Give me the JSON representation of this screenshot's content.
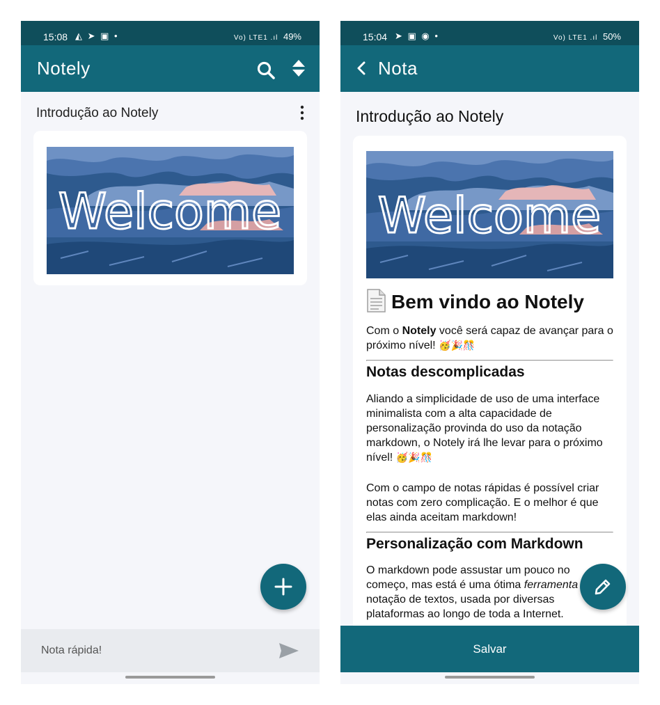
{
  "colors": {
    "status_bar": "#0f4e5b",
    "app_bar": "#12687a",
    "fab": "#12687a",
    "background": "#f5f6fa",
    "quick_bar": "#e9ebef"
  },
  "left": {
    "status": {
      "time": "15:08",
      "left_icons": "◭ ➤ ▣ •",
      "network": "Vo) LTE1 .ıl",
      "battery": "49%"
    },
    "app_title": "Notely",
    "icons": [
      "search-icon",
      "sort-icon",
      "more-vert-icon",
      "add-icon",
      "send-icon"
    ],
    "note": {
      "title": "Introdução ao Notely",
      "image_text": "Welcome"
    },
    "quick_note_placeholder": "Nota rápida!"
  },
  "right": {
    "status": {
      "time": "15:04",
      "left_icons": "➤ ▣ ◉ •",
      "network": "Vo) LTE1 .ıl",
      "battery": "50%"
    },
    "app_title": "Nota",
    "icons": [
      "back-icon",
      "document-icon",
      "edit-icon"
    ],
    "note_title": "Introdução ao Notely",
    "image_text": "Welcome",
    "content": {
      "h1": "Bem vindo ao Notely",
      "intro_pre": "Com o ",
      "intro_bold": "Notely",
      "intro_post": " você será capaz de avançar para o próximo nível!",
      "emoji": "🥳🎉🎊",
      "h2_1": "Notas descomplicadas",
      "p1": "Aliando a simplicidade de uso de uma interface minimalista com a alta capacidade de personalização provinda do uso da notação markdown, o Notely irá lhe levar para o próximo nível!",
      "p2": "Com o campo de notas rápidas é possível criar notas com zero complicação. E o melhor é que elas ainda aceitam markdown!",
      "h2_2": "Personalização com Markdown",
      "p3_pre": "O markdown pode assustar um pouco no começo, mas está é uma ótima ",
      "p3_em": "ferramenta",
      "p3_post": " de notação de textos, usada por diversas plataformas ao longo de toda a Internet."
    },
    "save_label": "Salvar"
  }
}
